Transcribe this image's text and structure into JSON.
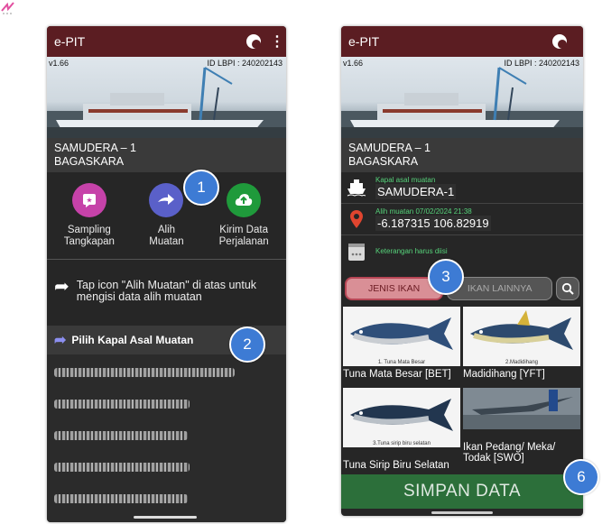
{
  "left": {
    "app_title": "e-PIT",
    "version": "v1.66",
    "id_lbpi": "ID LBPI : 240202143",
    "ship_name_1": "SAMUDERA – 1",
    "ship_name_2": "BAGASKARA",
    "menu": [
      {
        "label1": "Sampling",
        "label2": "Tangkapan"
      },
      {
        "label1": "Alih",
        "label2": "Muatan"
      },
      {
        "label1": "Kirim Data",
        "label2": "Perjalanan"
      }
    ],
    "hint": "Tap icon \"Alih Muatan\" di atas untuk mengisi data alih muatan",
    "sheet_title": "Pilih Kapal Asal Muatan"
  },
  "right": {
    "app_title": "e-PIT",
    "version": "v1.66",
    "id_lbpi": "ID LBPI : 240202143",
    "ship_name_1": "SAMUDERA – 1",
    "ship_name_2": "BAGASKARA",
    "fields": [
      {
        "label": "Kapal asal muatan",
        "value": "SAMUDERA-1"
      },
      {
        "label": "Alih muatan 07/02/2024 21:38",
        "value": "-6.187315 106.82919"
      },
      {
        "label": "Keterangan harus diisi",
        "value": ""
      }
    ],
    "tabs": {
      "active": "JENIS IKAN",
      "other": "IKAN LAINNYA"
    },
    "fish": [
      {
        "caption": "1.   Tuna Mata Besar",
        "name": "Tuna Mata Besar [BET]"
      },
      {
        "caption": "2.Madidihang",
        "name": "Madidihang [YFT]"
      },
      {
        "caption": "3.Tuna sirip biru selatan",
        "name": "Tuna Sirip Biru Selatan"
      },
      {
        "caption": "",
        "name": "Ikan Pedang/ Meka/ Todak [SWO]"
      }
    ],
    "save_label": "SIMPAN DATA"
  },
  "callouts": [
    "1",
    "2",
    "3",
    "6"
  ],
  "colors": {
    "appbar": "#5b1d22",
    "accent_blue": "#3d7bd4",
    "save_green": "#2c6f3a",
    "field_label_green": "#56d27a"
  }
}
